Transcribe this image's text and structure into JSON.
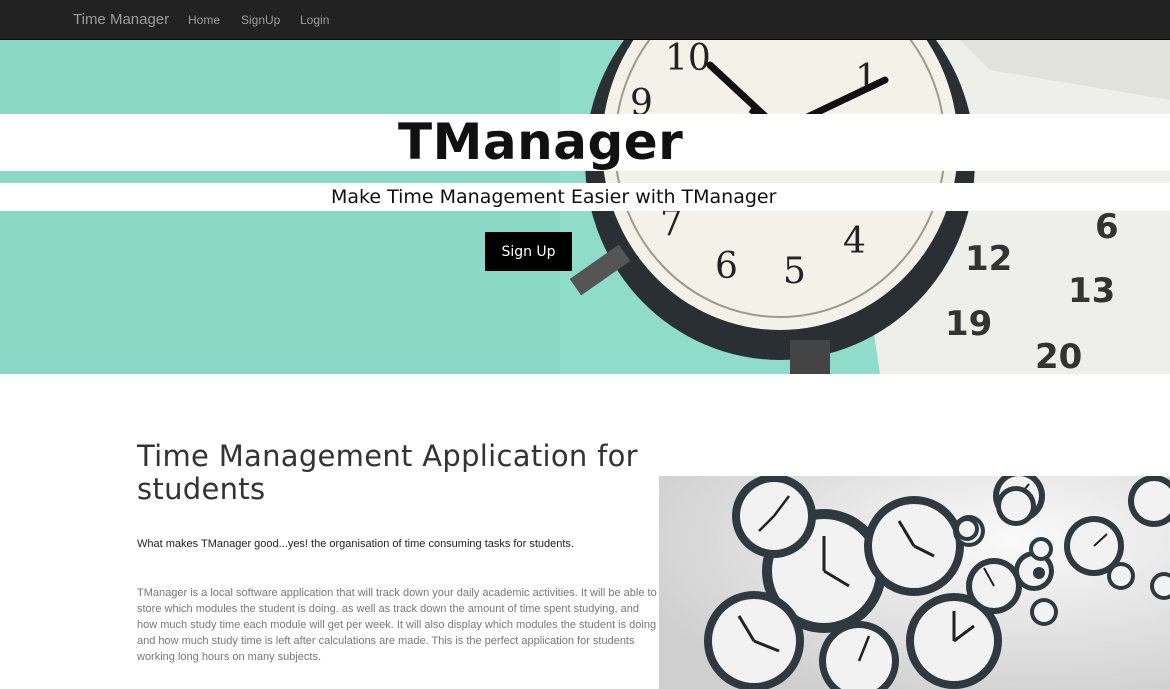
{
  "navbar": {
    "brand": "Time Manager",
    "links": [
      "Home",
      "SignUp",
      "Login"
    ]
  },
  "hero": {
    "title": "TManager",
    "subtitle": "Make Time Management Easier with TManager",
    "button_label": "Sign Up"
  },
  "content": {
    "heading": "Time Management Application for students",
    "lead": "What makes TManager good...yes! the organisation of time consuming tasks for students.",
    "description": "TManager is a local software application that will track down your daily academic activities. It will be able to store which modules the student is doing. as well as track down the amount of time spent studying, and how much study time each module will get per week. It will also display which modules the student is doing and how much study time is left after calculations are made. This is the perfect application for students working long hours on many subjects."
  },
  "images": {
    "hero_image": "alarm-clock-and-calendar-photo",
    "side_image": "floating-clocks-photo"
  },
  "colors": {
    "navbar_bg": "#222222",
    "nav_text": "#9d9d9d",
    "hero_teal": "#8fdccb",
    "button_bg": "#000000",
    "button_text": "#ffffff"
  }
}
